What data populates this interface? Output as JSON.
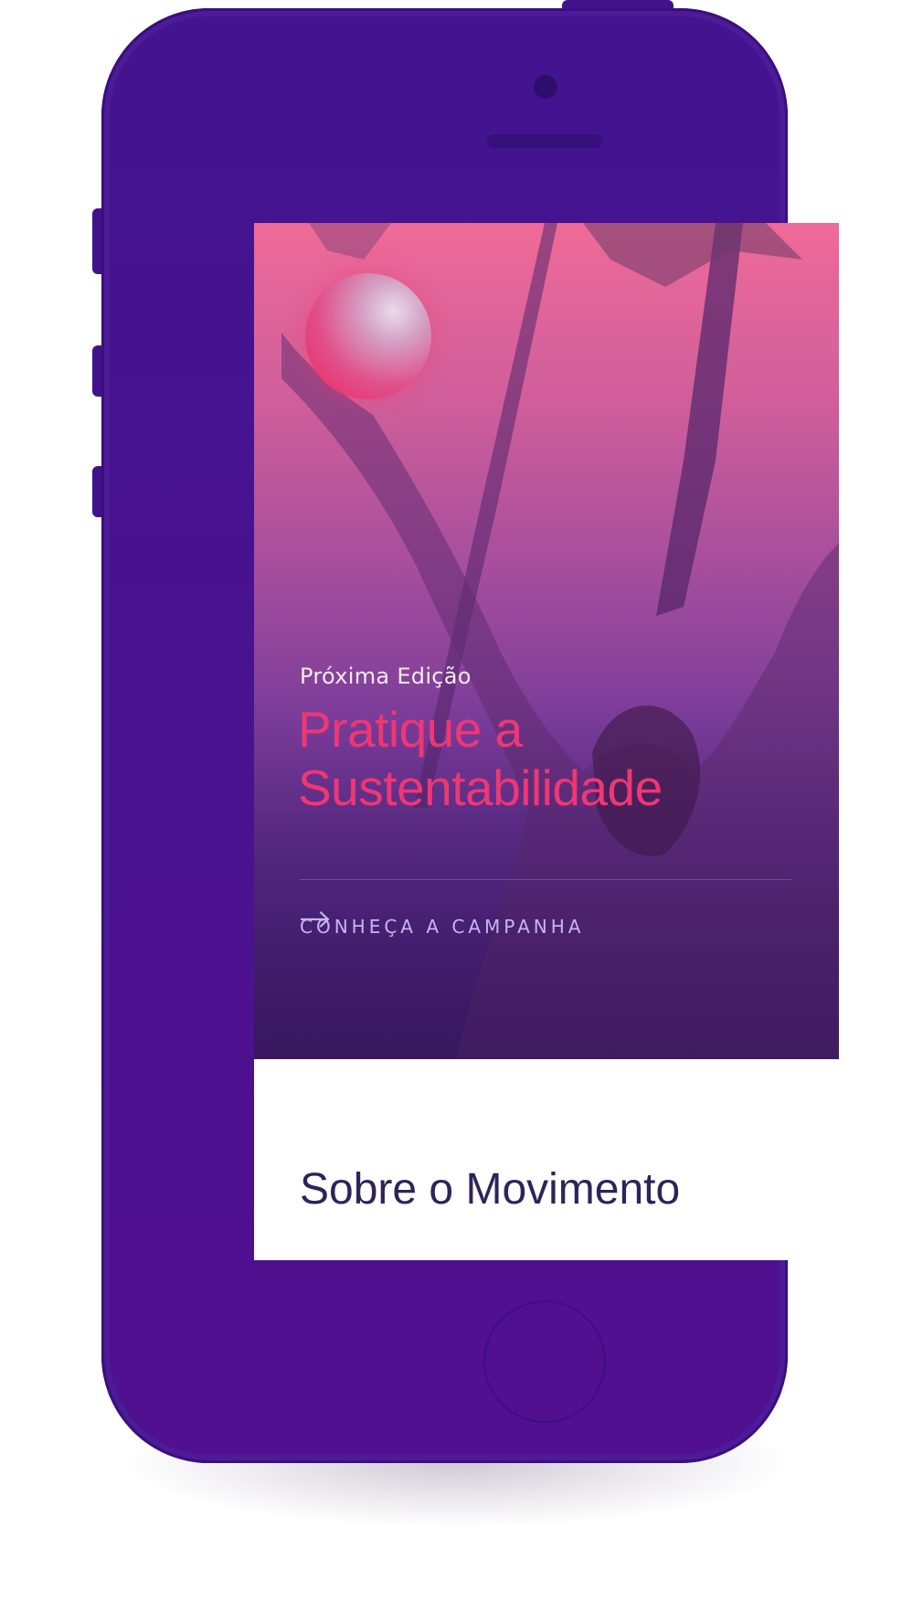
{
  "device": {
    "type": "smartphone",
    "color": "#4a128f",
    "icons": [
      "camera-icon",
      "speaker-icon",
      "home-button-icon"
    ]
  },
  "hero": {
    "eyebrow": "Próxima Edição",
    "headline": "Pratique a Sustentabilidade",
    "cta_label": "CONHEÇA A CAMPANHA",
    "cta_icon": "arrow-right-icon",
    "accent_color": "#ee3774",
    "cta_color": "#c7b6ee"
  },
  "section": {
    "title": "Sobre o Movimento",
    "title_color": "#2f2358"
  }
}
